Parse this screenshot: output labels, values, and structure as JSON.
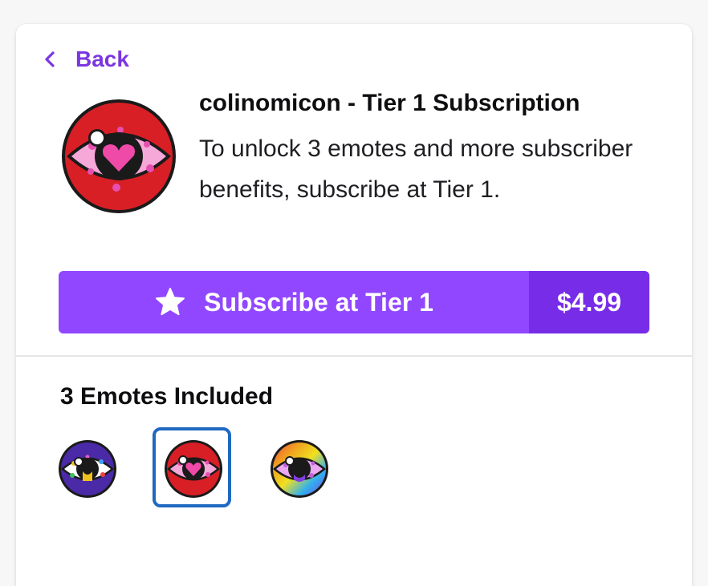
{
  "nav": {
    "back_label": "Back",
    "back_icon": "chevron-left-icon"
  },
  "subscription": {
    "channel_title": "colinomicon - Tier 1 Subscription",
    "description": "To unlock 3 emotes and more subscriber benefits, subscribe at Tier 1.",
    "avatar_icon": "eye-heart-avatar",
    "button_label": "Subscribe at Tier 1",
    "button_icon": "star-icon",
    "price": "$4.99"
  },
  "emotes": {
    "heading": "3 Emotes Included",
    "items": [
      {
        "name": "emote-purple-eye",
        "selected": false
      },
      {
        "name": "emote-red-heart-eye",
        "selected": true
      },
      {
        "name": "emote-rainbow-eye",
        "selected": false
      }
    ]
  },
  "colors": {
    "accent": "#9147ff",
    "accent_dark": "#772ce8",
    "link": "#7a37e0",
    "selected_border": "#1f69c1"
  }
}
